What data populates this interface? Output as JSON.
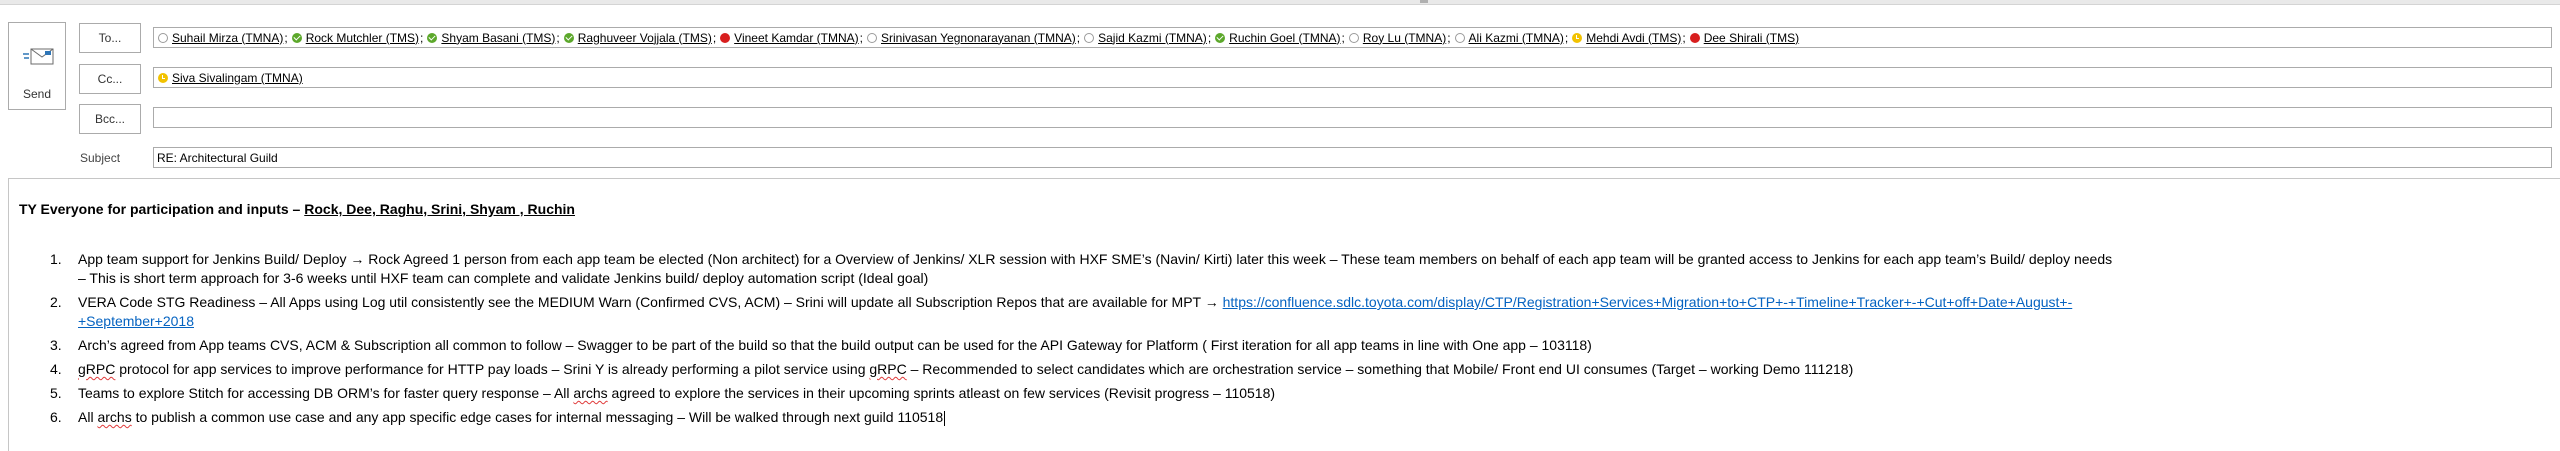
{
  "compose": {
    "send_label": "Send",
    "to_label": "To...",
    "cc_label": "Cc...",
    "bcc_label": "Bcc...",
    "subject_label": "Subject",
    "subject_value": "RE: Architectural Guild"
  },
  "to_recipients": [
    {
      "name": "Suhail Mirza (TMNA)",
      "status": "offline"
    },
    {
      "name": "Rock Mutchler (TMS)",
      "status": "available"
    },
    {
      "name": "Shyam Basani (TMS)",
      "status": "available"
    },
    {
      "name": "Raghuveer Vojjala (TMS)",
      "status": "available"
    },
    {
      "name": "Vineet Kamdar (TMNA)",
      "status": "busy"
    },
    {
      "name": "Srinivasan Yegnonarayanan (TMNA)",
      "status": "offline"
    },
    {
      "name": "Sajid Kazmi (TMNA)",
      "status": "offline"
    },
    {
      "name": "Ruchin Goel (TMNA)",
      "status": "available"
    },
    {
      "name": "Roy Lu (TMNA)",
      "status": "offline"
    },
    {
      "name": "Ali Kazmi (TMNA)",
      "status": "offline"
    },
    {
      "name": "Mehdi Avdi (TMS)",
      "status": "away"
    },
    {
      "name": "Dee Shirali (TMS)",
      "status": "busy"
    }
  ],
  "cc_recipients": [
    {
      "name": "Siva Sivalingam (TMNA)",
      "status": "away"
    }
  ],
  "presence_colors": {
    "available": "#5ca82b",
    "busy": "#d81e1e",
    "away": "#f2c200",
    "offline": "#9a9a9a"
  },
  "message": {
    "thanks_lead": "TY Everyone for participation and inputs – ",
    "thanks_names": "Rock, Dee, Raghu, Srini, Shyam , Ruchin",
    "items": [
      {
        "num": "1.",
        "line1": "App team support for Jenkins Build/ Deploy → Rock Agreed 1 person from each app team be elected (Non architect) for a Overview of Jenkins/ XLR session with HXF SME’s (Navin/ Kirti) later this week – These team members on behalf of each app team will be granted access to Jenkins for each app team’s Build/ deploy needs",
        "line2": "– This is short term approach for 3-6 weeks until HXF team can complete and validate Jenkins build/ deploy automation script  (Ideal goal)"
      },
      {
        "num": "2.",
        "text": "VERA Code STG Readiness – All Apps using Log util consistently see the MEDIUM Warn (Confirmed CVS, ACM) – Srini will update all Subscription Repos that are available for MPT → ",
        "link1": "https://confluence.sdlc.toyota.com/display/CTP/Registration+Services+Migration+to+CTP+-+Timeline+Tracker+-+Cut+off+Date+August+-",
        "link2": "+September+2018"
      },
      {
        "num": "3.",
        "text": "Arch’s agreed from App teams CVS, ACM & Subscription all common to follow – Swagger to be part of the build so that the build output can be used for the API Gateway for Platform ( First iteration for all app teams in line with One app – 103118)"
      },
      {
        "num": "4.",
        "w1": "gRPC",
        "t1": " protocol for app services  to improve performance for HTTP pay loads – Srini Y is already performing a pilot service using ",
        "w2": "gRPC",
        "t2": " – Recommended to select candidates which are orchestration service – something that Mobile/ Front end UI consumes (Target – working Demo 111218)"
      },
      {
        "num": "5.",
        "t1": "Teams to explore Stitch for accessing DB ORM’s for faster query response – All ",
        "w1": "archs",
        "t2": " agreed to explore the services in their upcoming sprints atleast on few services (Revisit progress – 110518)"
      },
      {
        "num": "6.",
        "t1": "All ",
        "w1": "archs",
        "t2": " to publish a common use case and any app specific edge cases for internal messaging – Will be walked through next guild 110518"
      }
    ]
  }
}
